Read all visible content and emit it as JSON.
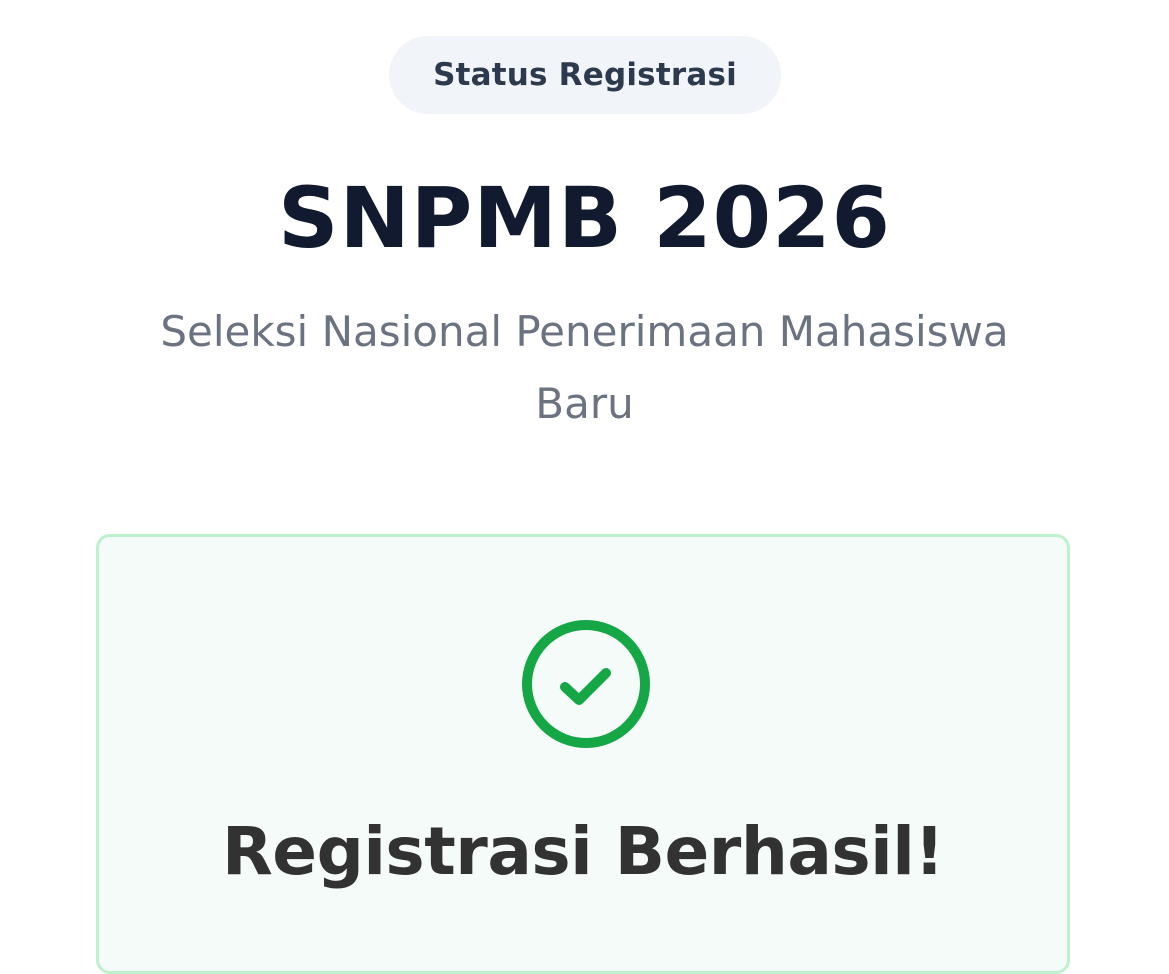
{
  "badge": {
    "label": "Status Registrasi"
  },
  "header": {
    "title": "SNPMB 2026",
    "subtitle": "Seleksi Nasional Penerimaan Mahasiswa Baru"
  },
  "result_card": {
    "icon": "check-circle-icon",
    "heading": "Registrasi Berhasil!"
  },
  "colors": {
    "success": "#15a646",
    "card_border": "#bdf0cc",
    "card_bg": "#f5fbf8",
    "title": "#111a2e",
    "subtitle": "#6b7280"
  }
}
